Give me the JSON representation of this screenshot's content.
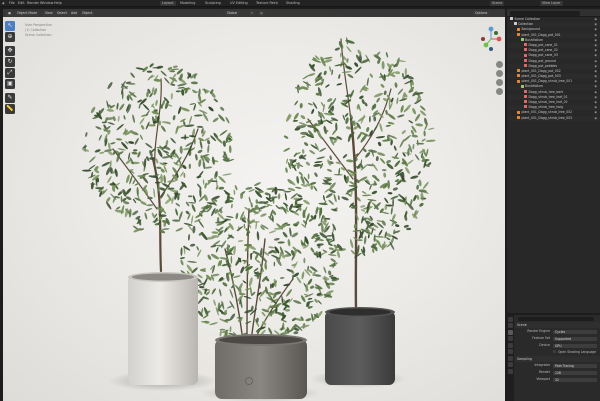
{
  "topbar": {
    "menu_items": [
      "File",
      "Edit",
      "Render",
      "Window",
      "Help"
    ],
    "workspace_tabs": [
      "Layout",
      "Modeling",
      "Sculpting",
      "UV Editing",
      "Texture Paint",
      "Shading"
    ],
    "scene": "Scene",
    "view_layer": "View Layer"
  },
  "viewport": {
    "mode": "Object Mode",
    "menus": [
      "View",
      "Select",
      "Add",
      "Object"
    ],
    "orientation": "Global",
    "options": "Options",
    "overlay_lines": [
      "User Perspective",
      "(1) Collection",
      "Scene Collection"
    ]
  },
  "outliner": {
    "rows": [
      {
        "label": "Scene Collection",
        "depth": 0,
        "icon": "collection-icon",
        "color": "#cfcfcf"
      },
      {
        "label": "Collection",
        "depth": 1,
        "icon": "collection-icon",
        "color": "#cfcfcf"
      },
      {
        "label": "Background",
        "depth": 2,
        "icon": "mesh-icon",
        "color": "#e0893a"
      },
      {
        "label": "plant_001_Dagg_pot_001",
        "depth": 2,
        "icon": "mesh-icon",
        "color": "#e0893a"
      },
      {
        "label": "Bushifolium",
        "depth": 3,
        "icon": "empty-icon",
        "color": "#9ccc65"
      },
      {
        "label": "Dagg_pot_cane_01",
        "depth": 4,
        "icon": "mesh-icon",
        "color": "#e06b6b"
      },
      {
        "label": "Dagg_pot_cane_02",
        "depth": 4,
        "icon": "mesh-icon",
        "color": "#e06b6b"
      },
      {
        "label": "Dagg_pot_cane_03",
        "depth": 4,
        "icon": "mesh-icon",
        "color": "#e06b6b"
      },
      {
        "label": "Dagg_pot_ground",
        "depth": 4,
        "icon": "mesh-icon",
        "color": "#e06b6b"
      },
      {
        "label": "Dagg_pot_pebbles",
        "depth": 4,
        "icon": "mesh-icon",
        "color": "#e06b6b"
      },
      {
        "label": "plant_001_Dagg_pot_002",
        "depth": 2,
        "icon": "mesh-icon",
        "color": "#e0893a"
      },
      {
        "label": "plant_001_Dagg_pot_003",
        "depth": 2,
        "icon": "mesh-icon",
        "color": "#e0893a"
      },
      {
        "label": "plant_001_Dagg_shrub_tree_001",
        "depth": 2,
        "icon": "mesh-icon",
        "color": "#e0893a"
      },
      {
        "label": "Bushifolium",
        "depth": 3,
        "icon": "empty-icon",
        "color": "#9ccc65"
      },
      {
        "label": "Dagg_shrub_tree_bark",
        "depth": 4,
        "icon": "mesh-icon",
        "color": "#e06b6b"
      },
      {
        "label": "Dagg_shrub_tree_leaf_01",
        "depth": 4,
        "icon": "mesh-icon",
        "color": "#e06b6b"
      },
      {
        "label": "Dagg_shrub_tree_leaf_02",
        "depth": 4,
        "icon": "mesh-icon",
        "color": "#e06b6b"
      },
      {
        "label": "Dagg_shrub_tree_twig",
        "depth": 4,
        "icon": "mesh-icon",
        "color": "#e06b6b"
      },
      {
        "label": "plant_001_Dagg_shrub_tree_002",
        "depth": 2,
        "icon": "mesh-icon",
        "color": "#e0893a"
      },
      {
        "label": "plant_001_Dagg_shrub_tree_003",
        "depth": 2,
        "icon": "mesh-icon",
        "color": "#e0893a"
      }
    ]
  },
  "properties": {
    "section_scene": "Scene",
    "rows": [
      {
        "label": "Render Engine",
        "value": "Cycles"
      },
      {
        "label": "Feature Set",
        "value": "Supported"
      },
      {
        "label": "Device",
        "value": "GPU"
      }
    ],
    "checkbox_label": "Open Shading Language",
    "section_sampling": "Sampling",
    "sampling_rows": [
      {
        "label": "Integrator",
        "value": "Path Tracing"
      },
      {
        "label": "Render",
        "value": "128"
      },
      {
        "label": "Viewport",
        "value": "32"
      }
    ]
  }
}
